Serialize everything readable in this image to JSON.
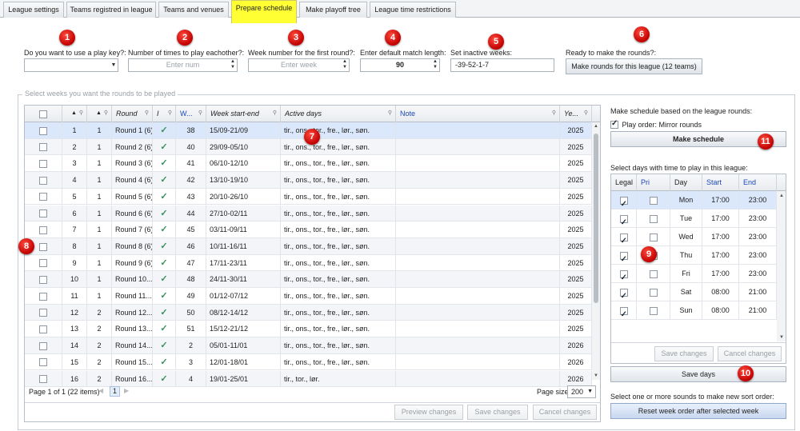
{
  "tabs": [
    "League settings",
    "Teams registred in league",
    "Teams and venues",
    "Prepare schedule",
    "Make playoff tree",
    "League time restrictions"
  ],
  "active_tab": "Prepare schedule",
  "badges": [
    "1",
    "2",
    "3",
    "4",
    "5",
    "6",
    "7",
    "8",
    "9",
    "10",
    "11"
  ],
  "form": {
    "play_key_label": "Do you want to use a play key?:",
    "times_label": "Number of times to play eachother?:",
    "times_placeholder": "Enter num",
    "week_label": "Week number for the first round?:",
    "week_placeholder": "Enter week",
    "match_length_label": "Enter default match length:",
    "match_length_value": "90",
    "inactive_label": "Set inactive weeks:",
    "inactive_value": "-39-52-1-7",
    "ready_label": "Ready to make the rounds?:",
    "make_rounds_button": "Make rounds for this league (12 teams)"
  },
  "weeks_group_title": "Select weeks you want the rounds to be played",
  "rounds_grid": {
    "headers": [
      "",
      "▲",
      "▲",
      "Round",
      "I",
      "W...",
      "Week start-end",
      "Active days",
      "Note",
      "Ye..."
    ],
    "rows": [
      {
        "a": "1",
        "b": "1",
        "round": "Round 1 (6)",
        "w": "38",
        "range": "15/09-21/09",
        "days": "tir., ons., tor., fre., lør., søn.",
        "year": "2025"
      },
      {
        "a": "2",
        "b": "1",
        "round": "Round 2 (6)",
        "w": "40",
        "range": "29/09-05/10",
        "days": "tir., ons., tor., fre., lør., søn.",
        "year": "2025"
      },
      {
        "a": "3",
        "b": "1",
        "round": "Round 3 (6)",
        "w": "41",
        "range": "06/10-12/10",
        "days": "tir., ons., tor., fre., lør., søn.",
        "year": "2025"
      },
      {
        "a": "4",
        "b": "1",
        "round": "Round 4 (6)",
        "w": "42",
        "range": "13/10-19/10",
        "days": "tir., ons., tor., fre., lør., søn.",
        "year": "2025"
      },
      {
        "a": "5",
        "b": "1",
        "round": "Round 5 (6)",
        "w": "43",
        "range": "20/10-26/10",
        "days": "tir., ons., tor., fre., lør., søn.",
        "year": "2025"
      },
      {
        "a": "6",
        "b": "1",
        "round": "Round 6 (6)",
        "w": "44",
        "range": "27/10-02/11",
        "days": "tir., ons., tor., fre., lør., søn.",
        "year": "2025"
      },
      {
        "a": "7",
        "b": "1",
        "round": "Round 7 (6)",
        "w": "45",
        "range": "03/11-09/11",
        "days": "tir., ons., tor., fre., lør., søn.",
        "year": "2025"
      },
      {
        "a": "8",
        "b": "1",
        "round": "Round 8 (6)",
        "w": "46",
        "range": "10/11-16/11",
        "days": "tir., ons., tor., fre., lør., søn.",
        "year": "2025"
      },
      {
        "a": "9",
        "b": "1",
        "round": "Round 9 (6)",
        "w": "47",
        "range": "17/11-23/11",
        "days": "tir., ons., tor., fre., lør., søn.",
        "year": "2025"
      },
      {
        "a": "10",
        "b": "1",
        "round": "Round 10...",
        "w": "48",
        "range": "24/11-30/11",
        "days": "tir., ons., tor., fre., lør., søn.",
        "year": "2025"
      },
      {
        "a": "11",
        "b": "1",
        "round": "Round 11...",
        "w": "49",
        "range": "01/12-07/12",
        "days": "tir., ons., tor., fre., lør., søn.",
        "year": "2025"
      },
      {
        "a": "12",
        "b": "2",
        "round": "Round 12...",
        "w": "50",
        "range": "08/12-14/12",
        "days": "tir., ons., tor., fre., lør., søn.",
        "year": "2025"
      },
      {
        "a": "13",
        "b": "2",
        "round": "Round 13...",
        "w": "51",
        "range": "15/12-21/12",
        "days": "tir., ons., tor., fre., lør., søn.",
        "year": "2025"
      },
      {
        "a": "14",
        "b": "2",
        "round": "Round 14...",
        "w": "2",
        "range": "05/01-11/01",
        "days": "tir., ons., tor., fre., lør., søn.",
        "year": "2026"
      },
      {
        "a": "15",
        "b": "2",
        "round": "Round 15...",
        "w": "3",
        "range": "12/01-18/01",
        "days": "tir., ons., tor., fre., lør., søn.",
        "year": "2026"
      },
      {
        "a": "16",
        "b": "2",
        "round": "Round 16...",
        "w": "4",
        "range": "19/01-25/01",
        "days": "tir., tor., lør.",
        "year": "2026"
      }
    ],
    "pager_text": "Page 1 of 1 (22 items)",
    "page_number": "1",
    "page_size_label": "Page size:",
    "page_size_value": "200",
    "preview_button": "Preview changes",
    "save_button": "Save changes",
    "cancel_button": "Cancel changes"
  },
  "right": {
    "schedule_label": "Make schedule based on the league rounds:",
    "play_order_label": "Play order: Mirror rounds",
    "make_schedule_button": "Make schedule",
    "days_label": "Select days with time to play in this league:",
    "days_headers": [
      "Legal",
      "Pri",
      "Day",
      "Start",
      "End"
    ],
    "days": [
      {
        "day": "Mon",
        "start": "17:00",
        "end": "23:00"
      },
      {
        "day": "Tue",
        "start": "17:00",
        "end": "23:00"
      },
      {
        "day": "Wed",
        "start": "17:00",
        "end": "23:00"
      },
      {
        "day": "Thu",
        "start": "17:00",
        "end": "23:00"
      },
      {
        "day": "Fri",
        "start": "17:00",
        "end": "23:00"
      },
      {
        "day": "Sat",
        "start": "08:00",
        "end": "21:00"
      },
      {
        "day": "Sun",
        "start": "08:00",
        "end": "21:00"
      }
    ],
    "days_save_button": "Save changes",
    "days_cancel_button": "Cancel changes",
    "save_days_button": "Save days",
    "sort_label": "Select one or more sounds to make new sort order:",
    "reset_button": "Reset week order after selected week"
  },
  "colors": {
    "active_tab": "#ffff33",
    "badge": "#d90000",
    "selected_row": "#dbe7fa",
    "check": "#3a8f5c"
  }
}
